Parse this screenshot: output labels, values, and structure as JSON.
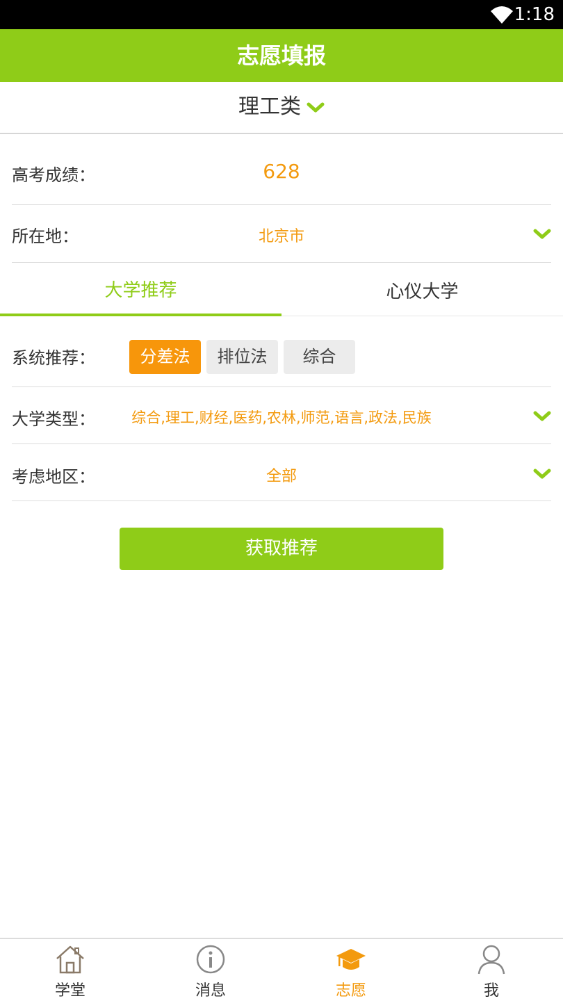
{
  "status_bar": {
    "time": "1:18",
    "wifi_icon": "wifi-icon"
  },
  "header": {
    "title": "志愿填报"
  },
  "category": {
    "selected": "理工类",
    "icon": "chevron-down-icon"
  },
  "form": {
    "score": {
      "label": "高考成绩：",
      "value": "628"
    },
    "location": {
      "label": "所在地：",
      "value": "北京市"
    }
  },
  "tabs": [
    {
      "label": "大学推荐",
      "active": true
    },
    {
      "label": "心仪大学",
      "active": false
    }
  ],
  "recommend": {
    "label": "系统推荐：",
    "methods": [
      {
        "label": "分差法",
        "selected": true
      },
      {
        "label": "排位法",
        "selected": false
      },
      {
        "label": "综合",
        "selected": false
      }
    ],
    "university_type": {
      "label": "大学类型：",
      "value": "综合,理工,财经,医药,农林,师范,语言,政法,民族"
    },
    "region": {
      "label": "考虑地区：",
      "value": "全部"
    }
  },
  "submit_label": "获取推荐",
  "bottom_nav": [
    {
      "label": "学堂",
      "icon": "home-icon",
      "active": false
    },
    {
      "label": "消息",
      "icon": "info-icon",
      "active": false
    },
    {
      "label": "志愿",
      "icon": "graduation-cap-icon",
      "active": true
    },
    {
      "label": "我",
      "icon": "user-icon",
      "active": false
    }
  ],
  "colors": {
    "primary_green": "#8fcc18",
    "accent_orange": "#f39a0e",
    "button_orange": "#f7960b"
  }
}
